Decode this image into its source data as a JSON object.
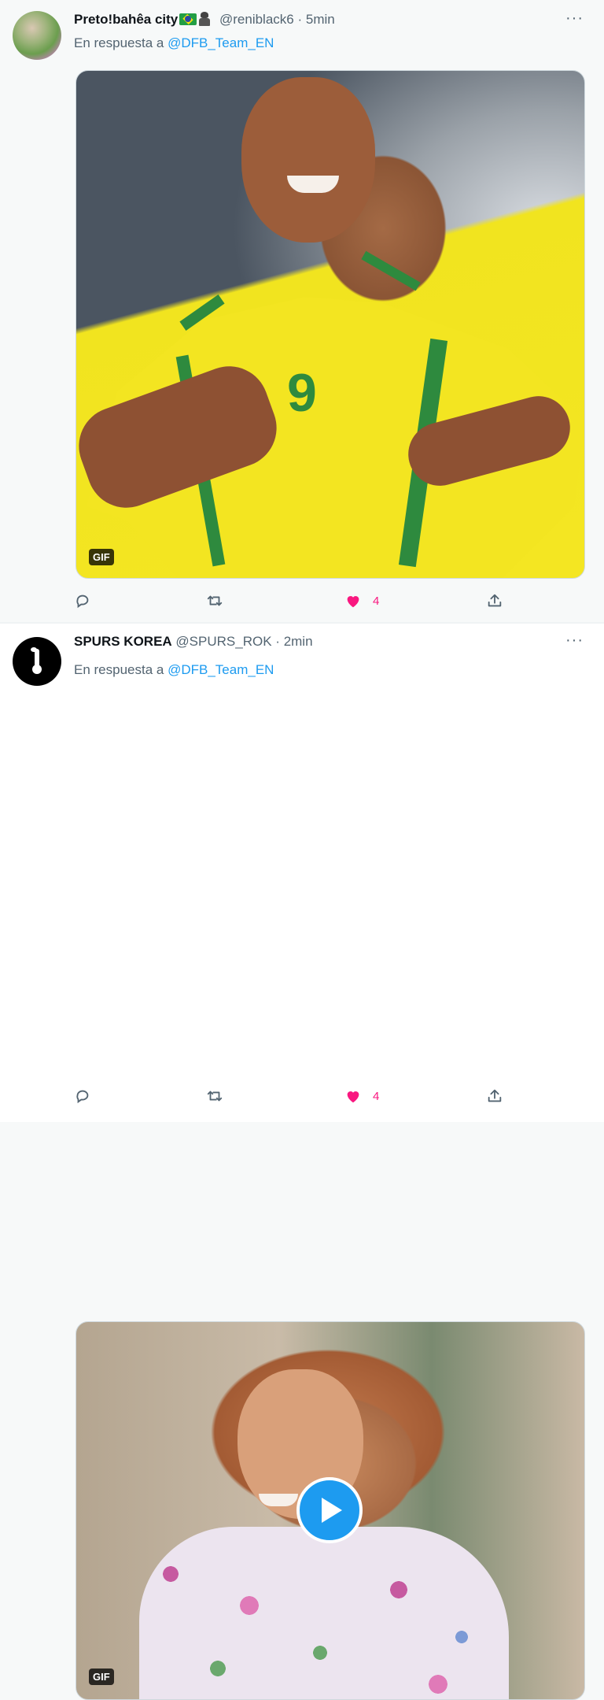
{
  "tweets": [
    {
      "author": {
        "name": "Preto!bahêa city",
        "handle": "@reniblack6",
        "time": "5min",
        "avatar_icon": "avatar-photo",
        "name_emojis": [
          "brazil-flag-emoji",
          "hooded-figure-emoji"
        ]
      },
      "reply_prefix": "En respuesta a",
      "reply_mention": "@DFB_Team_EN",
      "media": {
        "type": "gif",
        "badge": "GIF",
        "description_icon": "smiling-footballer-yellow-jersey"
      },
      "actions": {
        "reply_icon": "reply-icon",
        "retweet_icon": "retweet-icon",
        "like_icon": "heart-icon",
        "like_count": "4",
        "share_icon": "share-icon"
      }
    },
    {
      "author": {
        "name": "SPURS KOREA",
        "handle": "@SPURS_ROK",
        "time": "2min",
        "avatar_icon": "spurs-logo"
      },
      "reply_prefix": "En respuesta a",
      "reply_mention": "@DFB_Team_EN",
      "media": {
        "type": "gif",
        "badge": "GIF",
        "play_icon": "play-icon",
        "description_icon": "laughing-woman-floral-blouse"
      },
      "actions": {
        "reply_icon": "reply-icon",
        "retweet_icon": "retweet-icon",
        "like_icon": "heart-icon",
        "like_count": "4",
        "share_icon": "share-icon"
      }
    }
  ],
  "more_label": "···",
  "separator": "·",
  "colors": {
    "accent": "#1d9bf0",
    "like": "#f91880",
    "muted": "#536471",
    "text": "#0f1419"
  }
}
